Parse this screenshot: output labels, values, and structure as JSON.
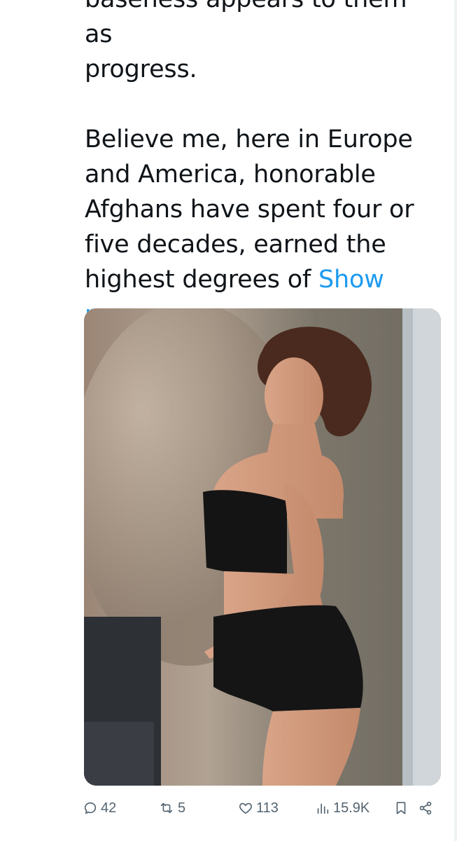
{
  "tweet": {
    "text_lines_top": [
      "baseness appears to them as",
      "progress."
    ],
    "text_lines_main": [
      "Believe me, here in Europe",
      "and America, honorable",
      "Afghans have spent four or",
      "five decades, earned the",
      "highest degrees of "
    ],
    "show_more_part1": "Show",
    "show_more_part2": "more"
  },
  "actions": {
    "replies": "42",
    "retweets": "5",
    "likes": "113",
    "views": "15.9K"
  },
  "colors": {
    "link": "#1d9bf0",
    "icon": "#536471",
    "text": "#0f1419"
  },
  "icons": [
    "reply-icon",
    "retweet-icon",
    "like-icon",
    "views-icon",
    "bookmark-icon",
    "share-icon"
  ]
}
